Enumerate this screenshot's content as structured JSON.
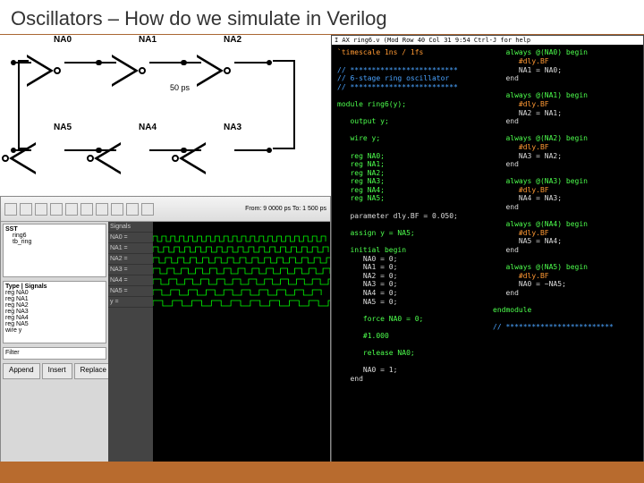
{
  "title": "Oscillators – How do we simulate in Verilog",
  "circuit": {
    "gates_top": [
      "NA0",
      "NA1",
      "NA2"
    ],
    "gates_bot": [
      "NA5",
      "NA4",
      "NA3"
    ],
    "delay_label": "50 ps"
  },
  "wave": {
    "toolbar_buttons": [
      "a",
      "b",
      "c",
      "d",
      "e",
      "f",
      "g",
      "h",
      "i",
      "j"
    ],
    "time_highlight": "From: 9 0000 ps   To: 1 500 ps",
    "tree_header": "SST",
    "tree_items": [
      "ring6",
      "tb_ring"
    ],
    "signals_header": "Signals",
    "signals": [
      "NA0",
      "NA1",
      "NA2",
      "NA3",
      "NA4",
      "NA5",
      "y"
    ],
    "type_header": "Type | Signals",
    "type_items": [
      "reg NA0",
      "reg NA1",
      "reg NA2",
      "reg NA3",
      "reg NA4",
      "reg NA5",
      "wire y"
    ],
    "filter_label": "Filter",
    "buttons": [
      "Append",
      "Insert",
      "Replace"
    ]
  },
  "editor": {
    "statusbar": "I AX  ring6.v (Mod    Row 40    Col 31    9:54  Ctrl-J for help",
    "timescale": "`timescale 1ns / 1fs",
    "comment_sep": "// *************************",
    "comment_title": "// 6-stage ring oscillator",
    "module_decl": "module ring6(y);",
    "output": "   output y;",
    "wire": "   wire y;",
    "regs": [
      "   reg NA0;",
      "   reg NA1;",
      "   reg NA2;",
      "   reg NA3;",
      "   reg NA4;",
      "   reg NA5;"
    ],
    "param": "   parameter dly.BF = 0.050;",
    "assign": "   assign y = NA5;",
    "initial": "   initial begin",
    "init_body": [
      "      NA0 = 0;",
      "      NA1 = 0;",
      "      NA2 = 0;",
      "      NA3 = 0;",
      "      NA4 = 0;",
      "      NA5 = 0;",
      "",
      "      force NA0 = 0;",
      "",
      "      #1.000",
      "",
      "      release NA0;",
      "",
      "      NA0 = 1;",
      "   end"
    ],
    "always_blocks": [
      {
        "head": "   always @(NA0) begin",
        "body": [
          "      #dly.BF",
          "      NA1 = NA0;",
          "   end"
        ]
      },
      {
        "head": "   always @(NA1) begin",
        "body": [
          "      #dly.BF",
          "      NA2 = NA1;",
          "   end"
        ]
      },
      {
        "head": "   always @(NA2) begin",
        "body": [
          "      #dly.BF",
          "      NA3 = NA2;",
          "   end"
        ]
      },
      {
        "head": "   always @(NA3) begin",
        "body": [
          "      #dly.BF",
          "      NA4 = NA3;",
          "   end"
        ]
      },
      {
        "head": "   always @(NA4) begin",
        "body": [
          "      #dly.BF",
          "      NA5 = NA4;",
          "   end"
        ]
      },
      {
        "head": "   always @(NA5) begin",
        "body": [
          "      #dly.BF",
          "      NA0 = ~NA5;",
          "   end"
        ]
      }
    ],
    "endmodule": "endmodule"
  }
}
